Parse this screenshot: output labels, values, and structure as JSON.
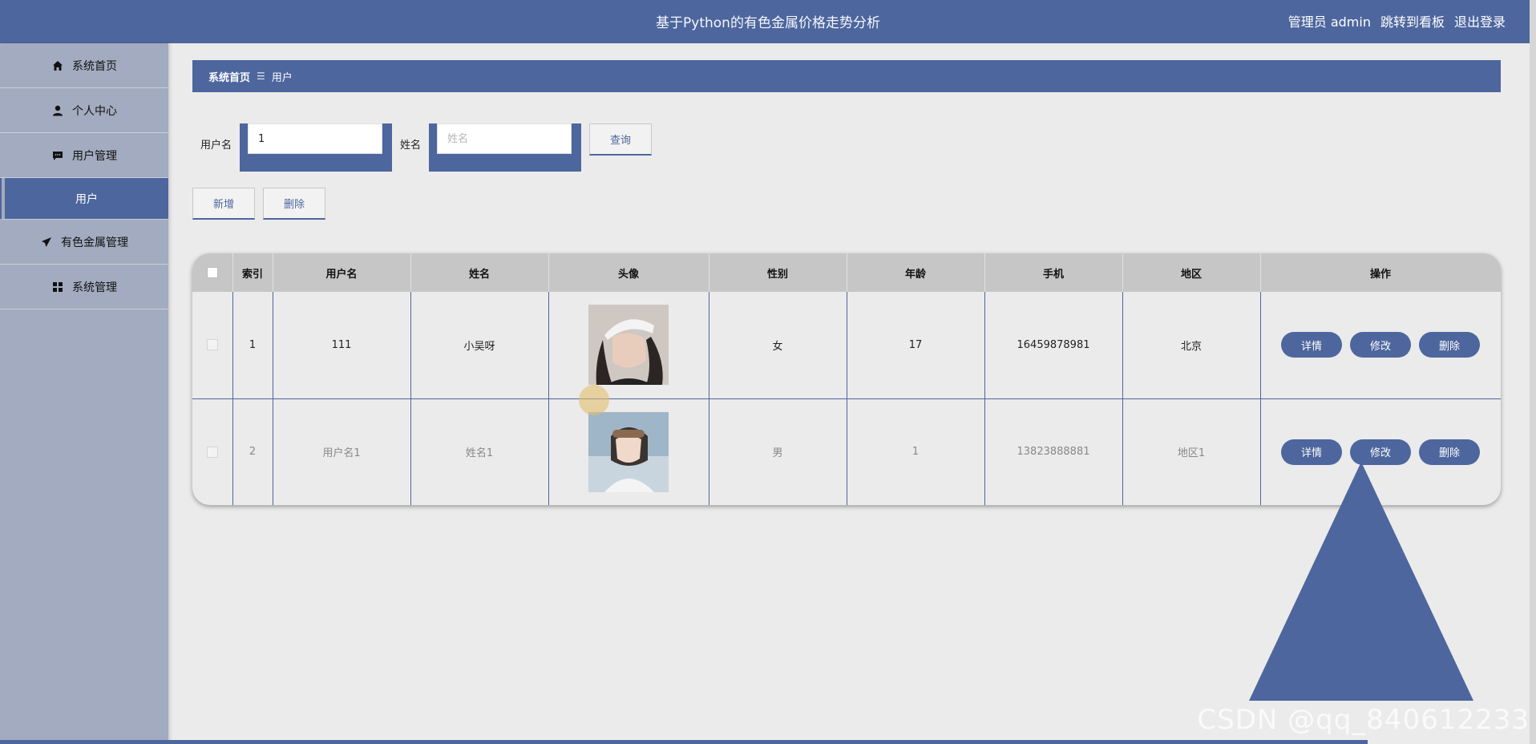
{
  "header": {
    "title": "基于Python的有色金属价格走势分析",
    "admin": "管理员 admin",
    "dashboard_link": "跳转到看板",
    "logout": "退出登录"
  },
  "sidebar": {
    "items": [
      {
        "label": "系统首页",
        "icon": "home-icon"
      },
      {
        "label": "个人中心",
        "icon": "user-icon"
      },
      {
        "label": "用户管理",
        "icon": "chat-icon"
      },
      {
        "label": "用户",
        "icon": ""
      },
      {
        "label": "有色金属管理",
        "icon": "paper-plane-icon"
      },
      {
        "label": "系统管理",
        "icon": "grid-icon"
      }
    ]
  },
  "breadcrumb": {
    "home": "系统首页",
    "separator": "☰",
    "current": "用户"
  },
  "search": {
    "username_label": "用户名",
    "username_value": "1",
    "name_label": "姓名",
    "name_placeholder": "姓名",
    "query_button": "查询"
  },
  "actions": {
    "add": "新增",
    "delete": "删除"
  },
  "table": {
    "headers": [
      "索引",
      "用户名",
      "姓名",
      "头像",
      "性别",
      "年龄",
      "手机",
      "地区",
      "操作"
    ],
    "rows": [
      {
        "index": "1",
        "username": "111",
        "name": "小吴呀",
        "gender": "女",
        "age": "17",
        "phone": "16459878981",
        "region": "北京"
      },
      {
        "index": "2",
        "username": "用户名1",
        "name": "姓名1",
        "gender": "男",
        "age": "1",
        "phone": "13823888881",
        "region": "地区1"
      }
    ],
    "ops": {
      "detail": "详情",
      "edit": "修改",
      "delete": "删除"
    }
  },
  "watermark": "CSDN @qq_840612233",
  "colors": {
    "primary": "#4d669d",
    "sidebar": "#a2abbf",
    "background": "#ebebeb"
  }
}
